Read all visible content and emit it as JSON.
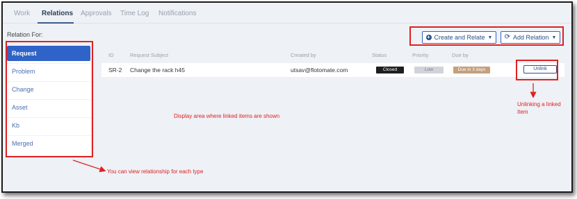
{
  "tabs": [
    {
      "label": "Work"
    },
    {
      "label": "Relations"
    },
    {
      "label": "Approvals"
    },
    {
      "label": "Time Log"
    },
    {
      "label": "Notifications"
    }
  ],
  "relation_for_label": "Relation For:",
  "sidebar": {
    "items": [
      {
        "label": "Request",
        "active": true
      },
      {
        "label": "Problem"
      },
      {
        "label": "Change"
      },
      {
        "label": "Asset"
      },
      {
        "label": "Kb"
      },
      {
        "label": "Merged"
      }
    ]
  },
  "actions": {
    "create_relate_label": "Create and Relate",
    "add_relation_label": "Add Relation"
  },
  "table": {
    "headers": [
      "ID",
      "Request Subject",
      "Created by",
      "Status",
      "Priority",
      "Due by"
    ],
    "rows": [
      {
        "id": "SR-2",
        "subject": "Change the rack h45",
        "created_by": "utsav@flotomate.com",
        "status": "Closed",
        "priority": "Low",
        "due": "Due in 3 days",
        "action": "Unlink"
      }
    ]
  },
  "annotations": {
    "display_area": "Display area where linked items are shown",
    "view_relationship": "You can view relationship for each type",
    "unlinking_line1": "Unlinking a linked",
    "unlinking_line2": "Item"
  },
  "colors": {
    "accent": "#2f63c8",
    "annotation": "#e02020",
    "status_closed": "#1e1e1e",
    "priority_low": "#d0d4da",
    "due_badge": "#c4a07f"
  }
}
